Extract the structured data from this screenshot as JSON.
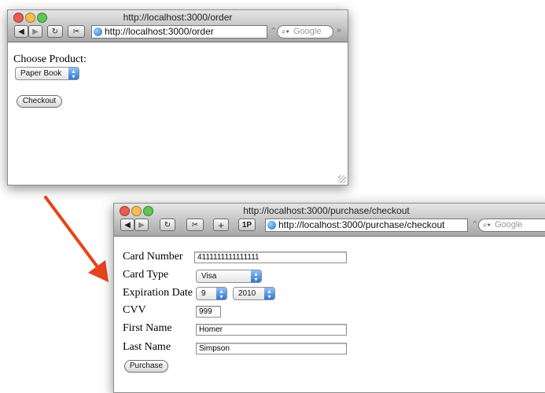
{
  "window1": {
    "title": "http://localhost:3000/order",
    "url": "http://localhost:3000/order",
    "search_placeholder": "Google",
    "choose_label": "Choose Product:",
    "product_selected": "Paper Book",
    "checkout_label": "Checkout"
  },
  "window2": {
    "title": "http://localhost:3000/purchase/checkout",
    "url": "http://localhost:3000/purchase/checkout",
    "search_placeholder": "Google",
    "plus_label": "+",
    "onepw_label": "1P",
    "fields": {
      "card_number_label": "Card Number",
      "card_number_value": "4111111111111111",
      "card_type_label": "Card Type",
      "card_type_value": "Visa",
      "expiration_label": "Expiration Date",
      "exp_month": "9",
      "exp_year": "2010",
      "cvv_label": "CVV",
      "cvv_value": "999",
      "first_name_label": "First Name",
      "first_name_value": "Homer",
      "last_name_label": "Last Name",
      "last_name_value": "Simpson"
    },
    "purchase_label": "Purchase"
  },
  "colors": {
    "arrow": "#e8431c",
    "close_light": "#ec5b4f",
    "min_light": "#f4bf4f",
    "zoom_light": "#5fc453"
  },
  "icons": {
    "back": "back-arrow-icon",
    "forward": "forward-arrow-icon",
    "reload": "reload-icon",
    "snip": "scissors-icon",
    "globe": "globe-icon",
    "search": "search-icon"
  }
}
